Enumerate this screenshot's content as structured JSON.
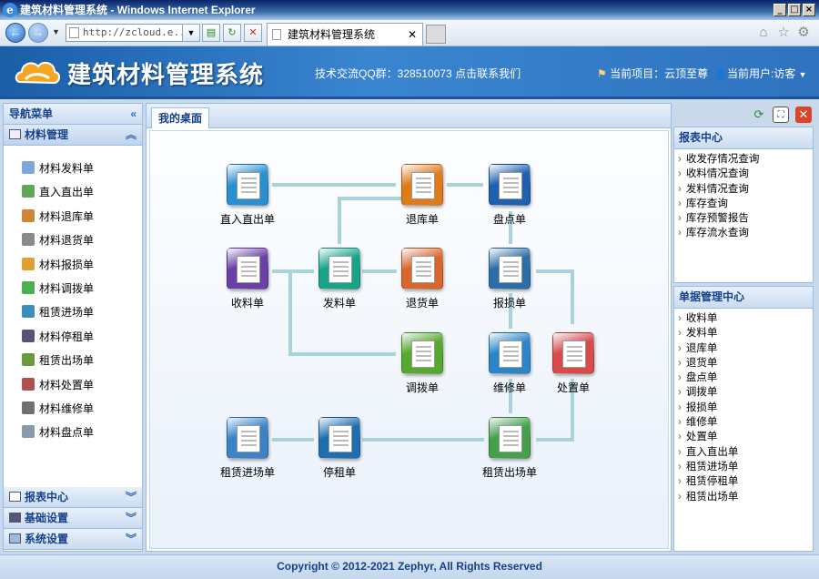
{
  "window": {
    "title": "建筑材料管理系统 - Windows Internet Explorer"
  },
  "browser": {
    "address": "http://zcloud.e...",
    "tab_title": "建筑材料管理系统",
    "tab_close": "✕"
  },
  "header": {
    "app_title": "建筑材料管理系统",
    "qq_text": "技术交流QQ群：328510073 点击联系我们",
    "project_text": "当前项目：云顶至尊",
    "user_text": "当前用户:访客"
  },
  "sidebar": {
    "title": "导航菜单",
    "section_title": "材料管理",
    "items": [
      {
        "label": "材料发料单",
        "color": "#7da7d9"
      },
      {
        "label": "直入直出单",
        "color": "#5fa55a"
      },
      {
        "label": "材料退库单",
        "color": "#d0843a"
      },
      {
        "label": "材料退货单",
        "color": "#8a8a8a"
      },
      {
        "label": "材料报损单",
        "color": "#e0a030"
      },
      {
        "label": "材料调拨单",
        "color": "#4caf50"
      },
      {
        "label": "租赁进场单",
        "color": "#3c8dbc"
      },
      {
        "label": "材料停租单",
        "color": "#555577"
      },
      {
        "label": "租赁出场单",
        "color": "#6a9a3a"
      },
      {
        "label": "材料处置单",
        "color": "#b05050"
      },
      {
        "label": "材料维修单",
        "color": "#707070"
      },
      {
        "label": "材料盘点单",
        "color": "#8899aa"
      }
    ],
    "bottom_sections": [
      "报表中心",
      "基础设置",
      "系统设置"
    ]
  },
  "main": {
    "tab_label": "我的桌面",
    "nodes": [
      {
        "label": "直入直出单",
        "color": "#2a8fd0"
      },
      {
        "label": "退库单",
        "color": "#e07b1a"
      },
      {
        "label": "盘点单",
        "color": "#1f5fb0"
      },
      {
        "label": "收料单",
        "color": "#6a3fa8"
      },
      {
        "label": "发料单",
        "color": "#17a58a"
      },
      {
        "label": "退货单",
        "color": "#d9662a"
      },
      {
        "label": "报损单",
        "color": "#2c6fa8"
      },
      {
        "label": "调拨单",
        "color": "#56a82e"
      },
      {
        "label": "维修单",
        "color": "#2a86c8"
      },
      {
        "label": "处置单",
        "color": "#d94a4a"
      },
      {
        "label": "租赁进场单",
        "color": "#3a83c6"
      },
      {
        "label": "停租单",
        "color": "#1f6fb0"
      },
      {
        "label": "租赁出场单",
        "color": "#46a04a"
      }
    ]
  },
  "reports": {
    "title": "报表中心",
    "items": [
      "收发存情况查询",
      "收料情况查询",
      "发料情况查询",
      "库存查询",
      "库存预警报告",
      "库存流水查询"
    ]
  },
  "documents": {
    "title": "单据管理中心",
    "items": [
      "收料单",
      "发料单",
      "退库单",
      "退货单",
      "盘点单",
      "调拨单",
      "报损单",
      "维修单",
      "处置单",
      "直入直出单",
      "租赁进场单",
      "租赁停租单",
      "租赁出场单"
    ]
  },
  "footer": {
    "copyright": "Copyright © 2012-2021 Zephyr, All Rights Reserved"
  }
}
